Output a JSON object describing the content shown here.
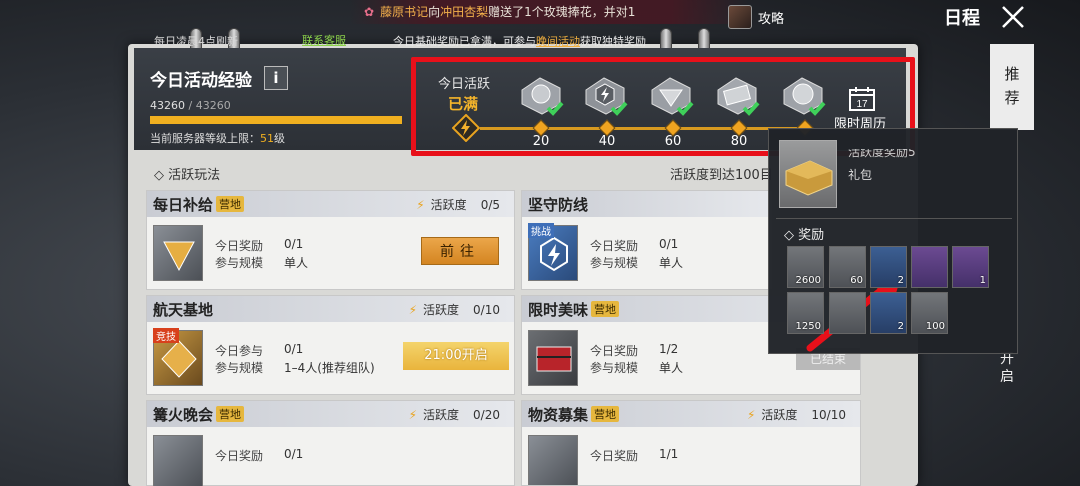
{
  "broadcast": {
    "player1": "藤原书记",
    "mid": "向",
    "player2": "冲田杏梨",
    "text": "赠送了1个玫瑰捧花，并对1"
  },
  "top_right": {
    "guide_label": "攻略",
    "schedule_title": "日程"
  },
  "header": {
    "refresh_note": "每日凌晨4点刷新",
    "support_link": "联系客服",
    "notice_pre": "今日基础奖励已拿满，可参与",
    "notice_link": "晚间活动",
    "notice_post": "获取独特奖励",
    "xp_title": "今日活动经验",
    "info_label": "i",
    "xp_current": "43260",
    "xp_sep": "/",
    "xp_max": "43260",
    "xp_progress": 1.0,
    "level_text": "当前服务器等级上限：",
    "level_value": "51",
    "level_unit": "级"
  },
  "activity": {
    "label": "今日活跃",
    "status": "已满",
    "milestones": [
      "20",
      "40",
      "60",
      "80"
    ],
    "calendar_label": "限时周历",
    "calendar_day": "17"
  },
  "section": {
    "title": "活跃玩法",
    "right_text": "活跃度到达100目"
  },
  "cards": [
    {
      "name": "每日补给",
      "tag": "营地",
      "hv_label": "活跃度",
      "hv_count": "0/5",
      "r1_label": "今日奖励",
      "r1_value": "0/1",
      "r2_label": "参与规模",
      "r2_value": "单人",
      "button": "前往"
    },
    {
      "name": "坚守防线",
      "badge": "挑战",
      "r1_label": "今日奖励",
      "r1_value": "0/1",
      "r2_label": "参与规模",
      "r2_value": "单人"
    },
    {
      "name": "航天基地",
      "badge": "竞技",
      "hv_label": "活跃度",
      "hv_count": "0/10",
      "r1_label": "今日参与",
      "r1_value": "0/1",
      "r2_label": "参与规模",
      "r2_value": "1–4人(推荐组队)",
      "button": "21:00开启"
    },
    {
      "name": "限时美味",
      "tag": "营地",
      "r1_label": "今日奖励",
      "r1_value": "1/2",
      "r2_label": "参与规模",
      "r2_value": "单人",
      "button": "已结束"
    },
    {
      "name": "篝火晚会",
      "tag": "营地",
      "hv_label": "活跃度",
      "hv_count": "0/20",
      "r1_label": "今日奖励",
      "r1_value": "0/1"
    },
    {
      "name": "物资募集",
      "tag": "营地",
      "hv_label": "活跃度",
      "hv_count": "10/10",
      "r1_label": "今日奖励",
      "r1_value": "1/1"
    }
  ],
  "right_tabs": {
    "recommend": "推荐",
    "open": "开启"
  },
  "popup": {
    "item_name": "活跃度奖励5",
    "item_type": "礼包",
    "reward_title": "奖励",
    "rewards": [
      {
        "q": "2600",
        "tier": "gray"
      },
      {
        "q": "60",
        "tier": "gray"
      },
      {
        "q": "2",
        "tier": "blue"
      },
      {
        "q": "",
        "tier": "purple"
      },
      {
        "q": "1",
        "tier": "purple"
      },
      {
        "q": "1250",
        "tier": "gray"
      },
      {
        "q": "",
        "tier": "gray"
      },
      {
        "q": "2",
        "tier": "blue"
      },
      {
        "q": "100",
        "tier": "gray"
      }
    ]
  },
  "colors": {
    "accent": "#f0b020",
    "highlight_box": "#e8101a",
    "check": "#3fd05a"
  }
}
